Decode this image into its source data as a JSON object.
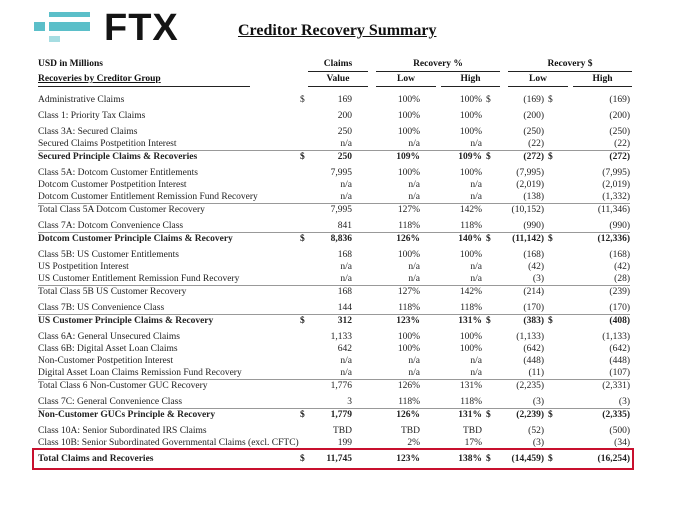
{
  "logo": {
    "wordmark": "FTX",
    "accent_color": "#5bbfc9"
  },
  "title": "Creditor Recovery Summary",
  "header": {
    "units": "USD in Millions",
    "group_label": "Recoveries by Creditor Group",
    "claims": "Claims",
    "claims_value": "Value",
    "recovery_pct": "Recovery %",
    "recovery_usd": "Recovery $",
    "low": "Low",
    "high": "High"
  },
  "rows": [
    {
      "label": "Administrative Claims",
      "d1": "$",
      "claims": "169",
      "pct_low": "100%",
      "pct_high": "100%",
      "d2": "$",
      "usd_low": "(169)",
      "d3": "$",
      "usd_high": "(169)"
    },
    {
      "label": "Class 1: Priority Tax Claims",
      "d1": "",
      "claims": "200",
      "pct_low": "100%",
      "pct_high": "100%",
      "d2": "",
      "usd_low": "(200)",
      "d3": "",
      "usd_high": "(200)"
    },
    {
      "label": "Class 3A: Secured Claims",
      "d1": "",
      "claims": "250",
      "pct_low": "100%",
      "pct_high": "100%",
      "d2": "",
      "usd_low": "(250)",
      "d3": "",
      "usd_high": "(250)"
    },
    {
      "label": "Secured Claims Postpetition Interest",
      "d1": "",
      "claims": "n/a",
      "pct_low": "n/a",
      "pct_high": "n/a",
      "d2": "",
      "usd_low": "(22)",
      "d3": "",
      "usd_high": "(22)"
    },
    {
      "label": "Secured Principle Claims & Recoveries",
      "d1": "$",
      "claims": "250",
      "pct_low": "109%",
      "pct_high": "109%",
      "d2": "$",
      "usd_low": "(272)",
      "d3": "$",
      "usd_high": "(272)"
    },
    {
      "label": "Class 5A: Dotcom Customer Entitlements",
      "d1": "",
      "claims": "7,995",
      "pct_low": "100%",
      "pct_high": "100%",
      "d2": "",
      "usd_low": "(7,995)",
      "d3": "",
      "usd_high": "(7,995)"
    },
    {
      "label": "Dotcom Customer Postpetition Interest",
      "d1": "",
      "claims": "n/a",
      "pct_low": "n/a",
      "pct_high": "n/a",
      "d2": "",
      "usd_low": "(2,019)",
      "d3": "",
      "usd_high": "(2,019)"
    },
    {
      "label": "Dotcom Customer Entitlement Remission Fund Recovery",
      "d1": "",
      "claims": "n/a",
      "pct_low": "n/a",
      "pct_high": "n/a",
      "d2": "",
      "usd_low": "(138)",
      "d3": "",
      "usd_high": "(1,332)"
    },
    {
      "label": "Total Class 5A Dotcom Customer Recovery",
      "d1": "",
      "claims": "7,995",
      "pct_low": "127%",
      "pct_high": "142%",
      "d2": "",
      "usd_low": "(10,152)",
      "d3": "",
      "usd_high": "(11,346)"
    },
    {
      "label": "Class 7A: Dotcom Convenience Class",
      "d1": "",
      "claims": "841",
      "pct_low": "118%",
      "pct_high": "118%",
      "d2": "",
      "usd_low": "(990)",
      "d3": "",
      "usd_high": "(990)"
    },
    {
      "label": "Dotcom Customer Principle Claims & Recovery",
      "d1": "$",
      "claims": "8,836",
      "pct_low": "126%",
      "pct_high": "140%",
      "d2": "$",
      "usd_low": "(11,142)",
      "d3": "$",
      "usd_high": "(12,336)"
    },
    {
      "label": "Class 5B: US Customer Entitlements",
      "d1": "",
      "claims": "168",
      "pct_low": "100%",
      "pct_high": "100%",
      "d2": "",
      "usd_low": "(168)",
      "d3": "",
      "usd_high": "(168)"
    },
    {
      "label": "US Postpetition Interest",
      "d1": "",
      "claims": "n/a",
      "pct_low": "n/a",
      "pct_high": "n/a",
      "d2": "",
      "usd_low": "(42)",
      "d3": "",
      "usd_high": "(42)"
    },
    {
      "label": "US Customer Entitlement Remission Fund Recovery",
      "d1": "",
      "claims": "n/a",
      "pct_low": "n/a",
      "pct_high": "n/a",
      "d2": "",
      "usd_low": "(3)",
      "d3": "",
      "usd_high": "(28)"
    },
    {
      "label": "Total Class 5B US Customer Recovery",
      "d1": "",
      "claims": "168",
      "pct_low": "127%",
      "pct_high": "142%",
      "d2": "",
      "usd_low": "(214)",
      "d3": "",
      "usd_high": "(239)"
    },
    {
      "label": "Class 7B: US Convenience Class",
      "d1": "",
      "claims": "144",
      "pct_low": "118%",
      "pct_high": "118%",
      "d2": "",
      "usd_low": "(170)",
      "d3": "",
      "usd_high": "(170)"
    },
    {
      "label": "US Customer Principle Claims & Recovery",
      "d1": "$",
      "claims": "312",
      "pct_low": "123%",
      "pct_high": "131%",
      "d2": "$",
      "usd_low": "(383)",
      "d3": "$",
      "usd_high": "(408)"
    },
    {
      "label": "Class 6A: General Unsecured Claims",
      "d1": "",
      "claims": "1,133",
      "pct_low": "100%",
      "pct_high": "100%",
      "d2": "",
      "usd_low": "(1,133)",
      "d3": "",
      "usd_high": "(1,133)"
    },
    {
      "label": "Class 6B: Digital Asset Loan Claims",
      "d1": "",
      "claims": "642",
      "pct_low": "100%",
      "pct_high": "100%",
      "d2": "",
      "usd_low": "(642)",
      "d3": "",
      "usd_high": "(642)"
    },
    {
      "label": "Non-Customer Postpetition Interest",
      "d1": "",
      "claims": "n/a",
      "pct_low": "n/a",
      "pct_high": "n/a",
      "d2": "",
      "usd_low": "(448)",
      "d3": "",
      "usd_high": "(448)"
    },
    {
      "label": "Digital Asset Loan Claims Remission Fund Recovery",
      "d1": "",
      "claims": "n/a",
      "pct_low": "n/a",
      "pct_high": "n/a",
      "d2": "",
      "usd_low": "(11)",
      "d3": "",
      "usd_high": "(107)"
    },
    {
      "label": "Total Class 6 Non-Customer GUC Recovery",
      "d1": "",
      "claims": "1,776",
      "pct_low": "126%",
      "pct_high": "131%",
      "d2": "",
      "usd_low": "(2,235)",
      "d3": "",
      "usd_high": "(2,331)"
    },
    {
      "label": "Class 7C: General Convenience Class",
      "d1": "",
      "claims": "3",
      "pct_low": "118%",
      "pct_high": "118%",
      "d2": "",
      "usd_low": "(3)",
      "d3": "",
      "usd_high": "(3)"
    },
    {
      "label": "Non-Customer GUCs Principle & Recovery",
      "d1": "$",
      "claims": "1,779",
      "pct_low": "126%",
      "pct_high": "131%",
      "d2": "$",
      "usd_low": "(2,239)",
      "d3": "$",
      "usd_high": "(2,335)"
    },
    {
      "label": "Class 10A: Senior Subordinated IRS Claims",
      "d1": "",
      "claims": "TBD",
      "pct_low": "TBD",
      "pct_high": "TBD",
      "d2": "",
      "usd_low": "(52)",
      "d3": "",
      "usd_high": "(500)"
    },
    {
      "label": "Class 10B: Senior Subordinated Governmental Claims (excl. CFTC)",
      "d1": "",
      "claims": "199",
      "pct_low": "2%",
      "pct_high": "17%",
      "d2": "",
      "usd_low": "(3)",
      "d3": "",
      "usd_high": "(34)"
    },
    {
      "label": "Total Claims and Recoveries",
      "d1": "$",
      "claims": "11,745",
      "pct_low": "123%",
      "pct_high": "138%",
      "d2": "$",
      "usd_low": "(14,459)",
      "d3": "$",
      "usd_high": "(16,254)"
    }
  ],
  "highlight_color": "#c8102e"
}
